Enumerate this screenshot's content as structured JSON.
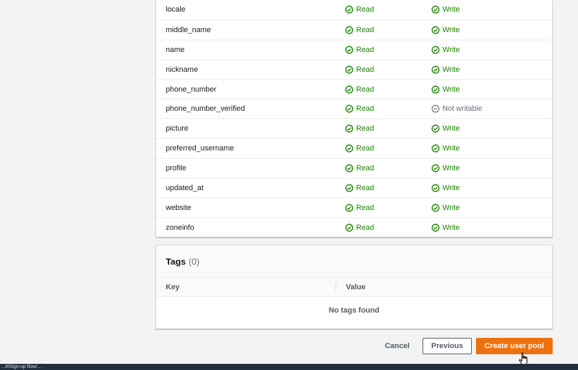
{
  "attributes": [
    {
      "name": "locale",
      "read": "Read",
      "write": "Write",
      "writable": true
    },
    {
      "name": "middle_name",
      "read": "Read",
      "write": "Write",
      "writable": true
    },
    {
      "name": "name",
      "read": "Read",
      "write": "Write",
      "writable": true
    },
    {
      "name": "nickname",
      "read": "Read",
      "write": "Write",
      "writable": true
    },
    {
      "name": "phone_number",
      "read": "Read",
      "write": "Write",
      "writable": true
    },
    {
      "name": "phone_number_verified",
      "read": "Read",
      "write": "Not writable",
      "writable": false
    },
    {
      "name": "picture",
      "read": "Read",
      "write": "Write",
      "writable": true
    },
    {
      "name": "preferred_username",
      "read": "Read",
      "write": "Write",
      "writable": true
    },
    {
      "name": "profile",
      "read": "Read",
      "write": "Write",
      "writable": true
    },
    {
      "name": "updated_at",
      "read": "Read",
      "write": "Write",
      "writable": true
    },
    {
      "name": "website",
      "read": "Read",
      "write": "Write",
      "writable": true
    },
    {
      "name": "zoneinfo",
      "read": "Read",
      "write": "Write",
      "writable": true
    }
  ],
  "tags": {
    "title": "Tags",
    "count": "(0)",
    "col_key": "Key",
    "col_value": "Value",
    "empty": "No tags found"
  },
  "footer": {
    "cancel": "Cancel",
    "previous": "Previous",
    "create": "Create user pool"
  },
  "status_bar": {
    "text": "...#/Sign-up flow/..."
  },
  "colors": {
    "success": "#1d8102",
    "muted": "#687078",
    "primary": "#ec7211",
    "background": "#f2f3f3"
  },
  "icons": {
    "read": "status-positive-icon",
    "write": "status-positive-icon",
    "not_writable": "status-stopped-icon",
    "cursor": "hand-pointer-cursor"
  }
}
